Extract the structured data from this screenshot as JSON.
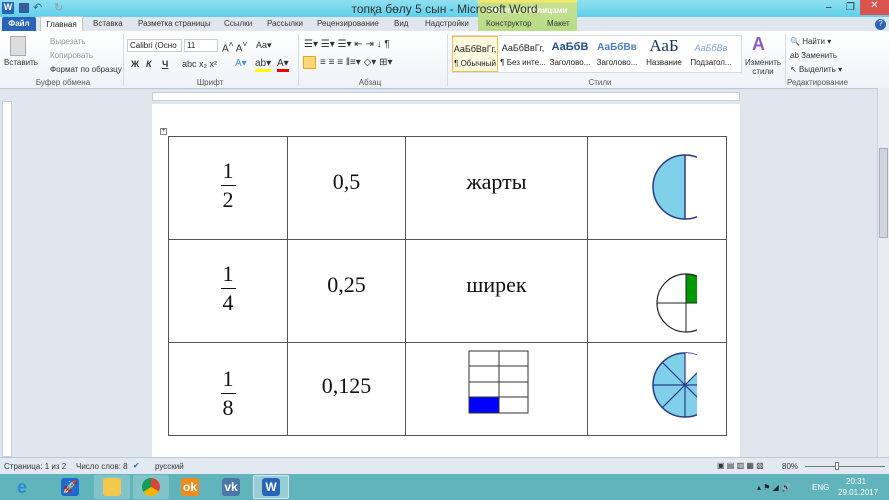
{
  "window": {
    "title": "топқа бөлу 5 сын  -  Microsoft Word",
    "context_tab": "Работа с таблицами"
  },
  "tabs": [
    "Файл",
    "Главная",
    "Вставка",
    "Разметка страницы",
    "Ссылки",
    "Рассылки",
    "Рецензирование",
    "Вид",
    "Надстройки",
    "Конструктор",
    "Макет"
  ],
  "clipboard": {
    "paste": "Вставить",
    "cut": "Вырезать",
    "copy": "Копировать",
    "format_painter": "Формат по образцу",
    "group": "Буфер обмена"
  },
  "font": {
    "name": "Calibri (Осно",
    "size": "11",
    "bold": "Ж",
    "italic": "К",
    "underline": "Ч",
    "group": "Шрифт"
  },
  "paragraph": {
    "group": "Абзац"
  },
  "styles": {
    "items": [
      {
        "sample": "АаБбВвГг,",
        "label": "¶ Обычный"
      },
      {
        "sample": "АаБбВвГг,",
        "label": "¶ Без инте..."
      },
      {
        "sample": "АаБбВ",
        "label": "Заголово..."
      },
      {
        "sample": "АаБбВв",
        "label": "Заголово..."
      },
      {
        "sample": "АаБ",
        "label": "Название"
      },
      {
        "sample": "АаБбВв",
        "label": "Подзагол..."
      }
    ],
    "change": "Изменить стили",
    "group": "Стили"
  },
  "editing": {
    "find": "Найти",
    "replace": "Заменить",
    "select": "Выделить",
    "group": "Редактирование"
  },
  "table": {
    "rows": [
      {
        "num": "1",
        "den": "2",
        "decimal": "0,5",
        "word": "жарты"
      },
      {
        "num": "1",
        "den": "4",
        "decimal": "0,25",
        "word": "ширек"
      },
      {
        "num": "1",
        "den": "8",
        "decimal": "0,125",
        "word": ""
      }
    ]
  },
  "colors": {
    "light_blue": "#7fd0e8",
    "green": "#009900",
    "blue": "#0000ff"
  },
  "status": {
    "page": "Страница: 1 из 2",
    "words": "Число слов: 8",
    "lang": "русский",
    "zoom": "80%"
  },
  "tray": {
    "lang": "ENG",
    "time": "20:31",
    "date": "29.01.2017"
  }
}
